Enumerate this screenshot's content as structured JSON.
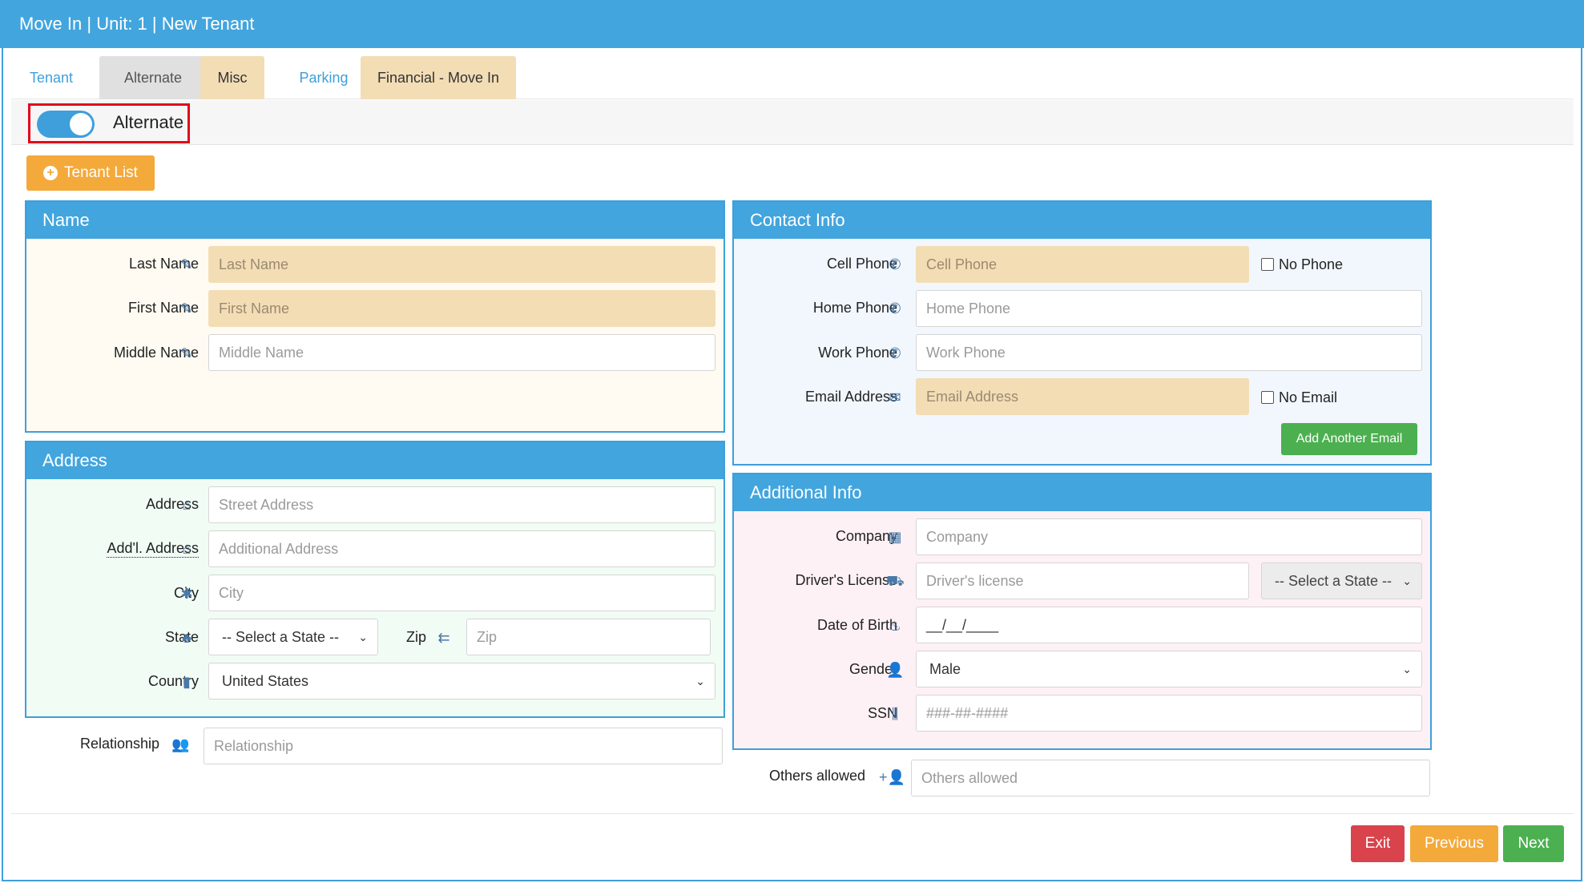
{
  "window": {
    "title": "Move In | Unit: 1 | New Tenant"
  },
  "tabs": [
    {
      "label": "Tenant",
      "style": "link"
    },
    {
      "label": "Alternate",
      "style": "active"
    },
    {
      "label": "Misc",
      "style": "beige"
    },
    {
      "label": "Parking",
      "style": "link"
    },
    {
      "label": "Financial - Move In",
      "style": "beige"
    }
  ],
  "toggle": {
    "label": "Alternate",
    "on": true
  },
  "buttons": {
    "tenant_list": "Tenant List",
    "add_email": "Add Another Email",
    "exit": "Exit",
    "previous": "Previous",
    "next": "Next"
  },
  "name_panel": {
    "title": "Name",
    "last_name": {
      "label": "Last Name",
      "placeholder": "Last Name",
      "value": ""
    },
    "first_name": {
      "label": "First Name",
      "placeholder": "First Name",
      "value": ""
    },
    "middle_name": {
      "label": "Middle Name",
      "placeholder": "Middle Name",
      "value": ""
    }
  },
  "address_panel": {
    "title": "Address",
    "address": {
      "label": "Address",
      "placeholder": "Street Address"
    },
    "addl_address": {
      "label": "Add'l. Address",
      "placeholder": "Additional Address"
    },
    "city": {
      "label": "City",
      "placeholder": "City"
    },
    "state": {
      "label": "State",
      "selected": "-- Select a State --"
    },
    "zip": {
      "label": "Zip",
      "placeholder": "Zip"
    },
    "country": {
      "label": "Country",
      "selected": "United States"
    }
  },
  "relationship": {
    "label": "Relationship",
    "placeholder": "Relationship"
  },
  "contact_panel": {
    "title": "Contact Info",
    "cell_phone": {
      "label": "Cell Phone",
      "placeholder": "Cell Phone"
    },
    "no_phone": "No Phone",
    "home_phone": {
      "label": "Home Phone",
      "placeholder": "Home Phone"
    },
    "work_phone": {
      "label": "Work Phone",
      "placeholder": "Work Phone"
    },
    "email": {
      "label": "Email Address",
      "placeholder": "Email Address"
    },
    "no_email": "No Email"
  },
  "additional_panel": {
    "title": "Additional Info",
    "company": {
      "label": "Company",
      "placeholder": "Company"
    },
    "drivers_license": {
      "label": "Driver's License",
      "placeholder": "Driver's license",
      "state_selected": "-- Select a State --"
    },
    "dob": {
      "label": "Date of Birth",
      "value": "__/__/____"
    },
    "gender": {
      "label": "Gender",
      "selected": "Male"
    },
    "ssn": {
      "label": "SSN",
      "placeholder": "###-##-####"
    }
  },
  "others_allowed": {
    "label": "Others allowed",
    "placeholder": "Others allowed"
  },
  "colors": {
    "header_blue": "#42a5de",
    "required_beige": "#f3ddb5",
    "orange": "#f4a93b",
    "green": "#4cb050",
    "red": "#d9434b",
    "highlight_red": "#e0081a"
  }
}
